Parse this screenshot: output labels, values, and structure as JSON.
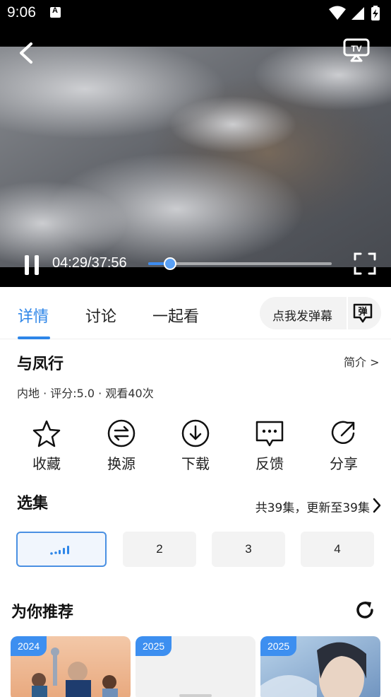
{
  "status_bar": {
    "time": "9:06",
    "icons": [
      "notification-a-icon",
      "wifi-icon",
      "signal-icon",
      "battery-charging-icon"
    ]
  },
  "player": {
    "current_time": "04:29/37:56",
    "progress": 0.118,
    "state": "playing",
    "icons": [
      "back-icon",
      "tv-cast-icon",
      "pause-icon",
      "fullscreen-icon"
    ]
  },
  "tabs": {
    "items": [
      {
        "label": "详情",
        "active": true
      },
      {
        "label": "讨论",
        "active": false
      },
      {
        "label": "一起看",
        "active": false
      }
    ],
    "danmu_label": "点我发弹幕",
    "danmu_icon_text": "弹"
  },
  "detail": {
    "title": "与凤行",
    "intro_link": "简介 >",
    "meta": "内地 · 评分:5.0 · 观看40次"
  },
  "actions": [
    {
      "label": "收藏",
      "icon": "star-icon"
    },
    {
      "label": "换源",
      "icon": "switch-source-icon"
    },
    {
      "label": "下载",
      "icon": "download-icon"
    },
    {
      "label": "反馈",
      "icon": "feedback-icon"
    },
    {
      "label": "分享",
      "icon": "share-icon"
    }
  ],
  "episodes": {
    "title": "选集",
    "summary": "共39集，更新至39集",
    "items": [
      "",
      "2",
      "3",
      "4"
    ],
    "active_index": 0
  },
  "recommend": {
    "title": "为你推荐",
    "cards": [
      {
        "year": "2024"
      },
      {
        "year": "2025"
      },
      {
        "year": "2025"
      }
    ]
  },
  "colors": {
    "accent": "#2e86e8",
    "badge": "#3d8ff0"
  }
}
